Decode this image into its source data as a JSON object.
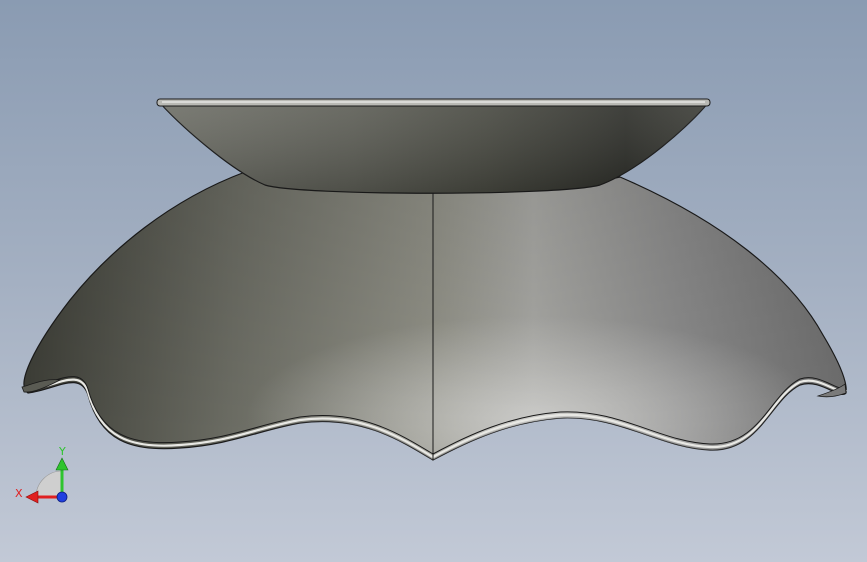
{
  "viewport": {
    "background_top": "#8a9bb2",
    "background_bottom": "#c2c9d6"
  },
  "model": {
    "shade_color": "#7f7f78",
    "edge_color": "#1a1a1a"
  },
  "triad": {
    "x_label": "X",
    "y_label": "Y",
    "x_color": "#e02020",
    "y_color": "#2ec42e",
    "z_color": "#1f3fe0"
  }
}
